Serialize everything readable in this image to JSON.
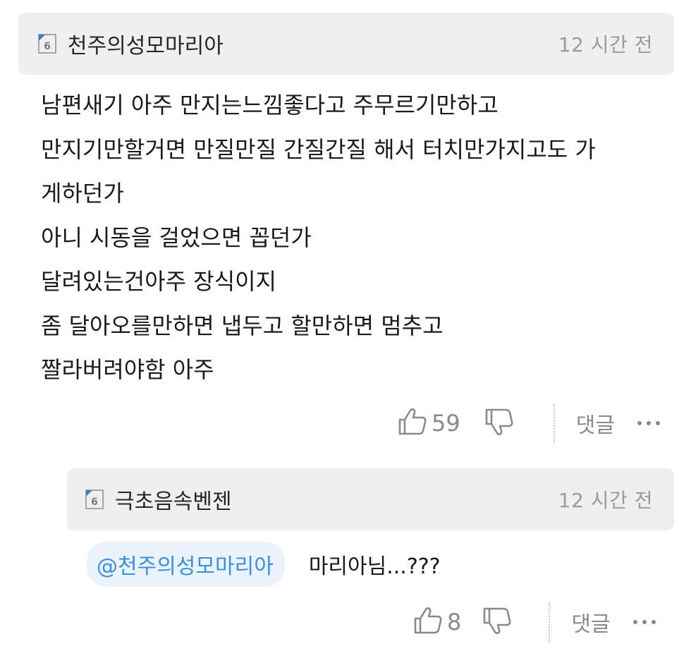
{
  "comments": [
    {
      "author": "천주의성모마리아",
      "time": "12 시간 전",
      "level_badge": "6",
      "lines": [
        "남편새기 아주 만지는느낌좋다고 주무르기만하고",
        "만지기만할거면 만질만질 간질간질 해서 터치만가지고도 가",
        "게하던가",
        "아니 시동을 걸었으면 꼽던가",
        "달려있는건아주 장식이지",
        "좀 달아오를만하면 냅두고 할만하면 멈추고",
        "짤라버려야함 아주"
      ],
      "likes": "59",
      "reply_label": "댓글"
    },
    {
      "author": "극초음속벤젠",
      "time": "12 시간 전",
      "level_badge": "6",
      "mention": "@천주의성모마리아",
      "text": "마리아님...???",
      "likes": "8",
      "reply_label": "댓글"
    }
  ],
  "colors": {
    "header_bg": "#efefef",
    "mention_bg": "#eaf3fc",
    "mention_text": "#3a8fe0",
    "muted_text": "#8a8a8a"
  },
  "icons": {
    "level": "level-badge-icon",
    "like": "thumbs-up-icon",
    "dislike": "thumbs-down-icon",
    "more": "more-dots-icon"
  }
}
